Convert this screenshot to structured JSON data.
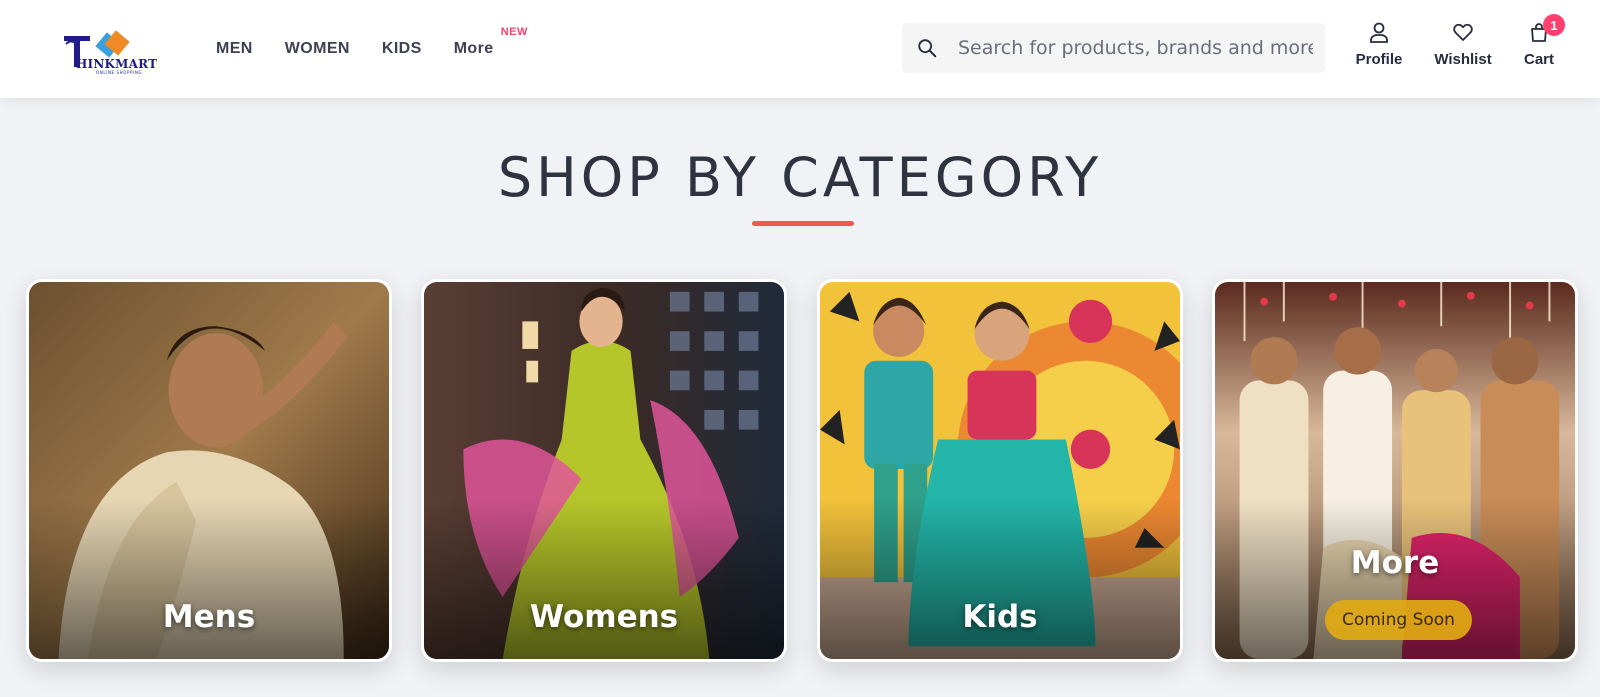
{
  "brand": {
    "logo_text": "HINKMART",
    "logo_tagline": "ONLINE SHOPPING"
  },
  "nav": {
    "items": [
      "MEN",
      "WOMEN",
      "KIDS"
    ],
    "more_label": "More",
    "more_badge": "NEW"
  },
  "search": {
    "placeholder": "Search for products, brands and more"
  },
  "actions": {
    "profile": "Profile",
    "wishlist": "Wishlist",
    "cart": "Cart",
    "cart_count": "1"
  },
  "section": {
    "title": "SHOP BY CATEGORY"
  },
  "categories": [
    {
      "label": "Mens"
    },
    {
      "label": "Womens"
    },
    {
      "label": "Kids"
    },
    {
      "label": "More",
      "badge": "Coming Soon"
    }
  ],
  "colors": {
    "accent": "#ff3f6c",
    "underline": "#ee5a4f",
    "badge": "#e2aa14"
  }
}
